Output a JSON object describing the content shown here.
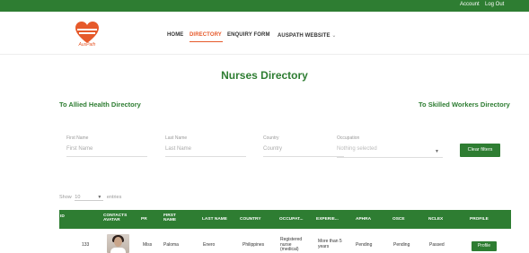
{
  "topbar": {
    "account": "Account",
    "logout": "Log Out"
  },
  "brand": {
    "logo_text": "AusPath"
  },
  "nav": {
    "home": "HOME",
    "directory": "DIRECTORY",
    "enquiry": "ENQUIRY FORM",
    "website": "AUSPATH WEBSITE",
    "website_caret": "⌄"
  },
  "page": {
    "title": "Nurses Directory"
  },
  "links": {
    "allied": "To Allied Health Directory",
    "skilled": "To Skilled Workers Directory"
  },
  "filters": {
    "first_name_label": "First Name",
    "first_name_placeholder": "First Name",
    "last_name_label": "Last Name",
    "last_name_placeholder": "Last Name",
    "country_label": "Country",
    "country_placeholder": "Country",
    "occupation_label": "Occupation",
    "occupation_value": "Nothing selected",
    "clear_label": "Clear filters"
  },
  "entries": {
    "show": "Show",
    "value": "10",
    "suffix": "entries"
  },
  "table": {
    "headers": {
      "id": "ID",
      "contacts": "CONTACTS",
      "avatar": "AVATAR",
      "pr": "PR",
      "first": "FIRST",
      "name": "NAME",
      "last": "LAST NAME",
      "country": "COUNTRY",
      "occupation": "OCCUPAT...",
      "experience": "EXPERIE...",
      "aphra": "APHRA",
      "osce": "OSCE",
      "nclex": "NCLEX",
      "profile": "PROFILE"
    },
    "rows": [
      {
        "id": "133",
        "pr": "Miss",
        "first": "Paloma",
        "last": "Enero",
        "country": "Philippines",
        "occupation": "Registered nurse (medical)",
        "experience": "More than 5 years",
        "aphra": "Pending",
        "osce": "Pending",
        "nclex": "Passed",
        "profile": "Profile"
      }
    ]
  },
  "colors": {
    "primary": "#2e7d32",
    "accent": "#e65a2b"
  }
}
